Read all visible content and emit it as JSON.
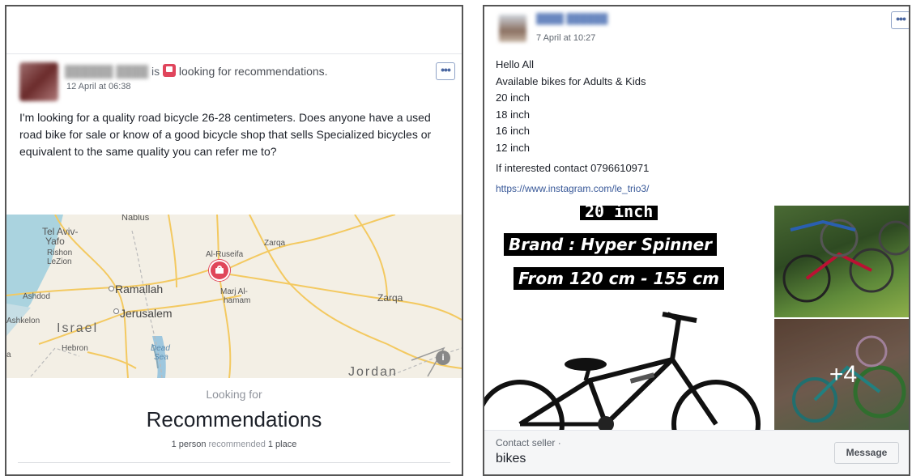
{
  "left_post": {
    "author_redacted": "██████ ████",
    "is_word": "is",
    "activity": "looking for recommendations.",
    "timestamp": "12 April at 06:38",
    "body": "I'm looking for a quality road bicycle 26-28 centimeters. Does anyone have a used road bike for sale or know of a good bicycle shop that sells Specialized bicycles or equivalent to the same quality you can refer me to?",
    "map_labels": {
      "nablus": "Nablus",
      "tel_aviv": "Tel Aviv-",
      "yafo": "Yafo",
      "rishon": "Rishon",
      "lezion": "LeZion",
      "ashdod": "Ashdod",
      "ramallah": "Ramallah",
      "jerusalem": "Jerusalem",
      "ashkelon": "Ashkelon",
      "israel": "Israel",
      "hebron": "Hebron",
      "dead": "Dead",
      "sea": "Sea",
      "al_ruseifa": "Al-Ruseifa",
      "zarqa_top": "Zarqa",
      "marj_al": "Marj Al-",
      "hamam": "hamam",
      "zarqa_right": "Zarqa",
      "jordan": "Jordan",
      "a": "a"
    },
    "looking_for": "Looking for",
    "recommendations": "Recommendations",
    "rec_count_person": "1 person",
    "rec_middle": " recommended ",
    "rec_count_place": "1 place"
  },
  "right_post": {
    "author_redacted": "████ ██████",
    "timestamp": "7 April at 10:27",
    "lines": [
      "Hello All",
      "Available bikes for Adults & Kids",
      "20 inch",
      "18 inch",
      "16 inch",
      "12 inch"
    ],
    "contact_line": "If interested contact 0796610971",
    "link": "https://www.instagram.com/le_trio3/",
    "promo": {
      "size": "20 inch",
      "brand": "Brand : Hyper Spinner",
      "range": "From 120 cm - 155 cm"
    },
    "more_photos": "+4",
    "contact_seller": "Contact seller ·",
    "item_title": "bikes",
    "message_btn": "Message"
  },
  "colors": {
    "pin": "#e0465a",
    "link": "#385898",
    "badge": "#e0455c"
  }
}
